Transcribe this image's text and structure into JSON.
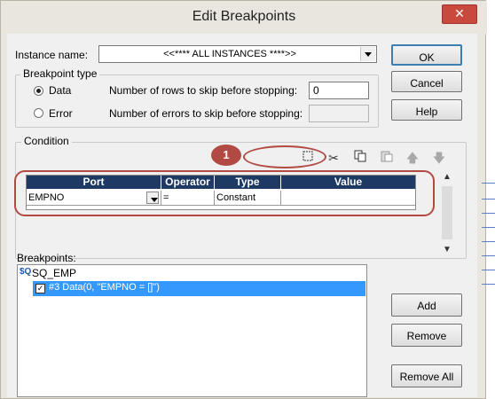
{
  "window": {
    "title": "Edit Breakpoints",
    "close_glyph": "✕"
  },
  "instance": {
    "label": "Instance name:",
    "value": "<<**** ALL INSTANCES ****>>"
  },
  "buttons": {
    "ok": "OK",
    "cancel": "Cancel",
    "help": "Help",
    "add": "Add",
    "remove": "Remove",
    "remove_all": "Remove All"
  },
  "breakpoint_type": {
    "title": "Breakpoint type",
    "data": {
      "label": "Data",
      "selected": true,
      "skip_label": "Number of rows to skip before stopping:",
      "skip_value": "0"
    },
    "error": {
      "label": "Error",
      "selected": false,
      "skip_label": "Number of errors to skip before stopping:",
      "skip_value": ""
    }
  },
  "condition": {
    "title": "Condition",
    "toolbar": [
      "new-icon",
      "cut-icon",
      "copy-icon",
      "paste-icon",
      "move-up-icon",
      "move-down-icon"
    ],
    "columns": [
      "Port",
      "Operator",
      "Type",
      "Value"
    ],
    "rows": [
      {
        "port": "EMPNO",
        "operator": "=",
        "type": "Constant",
        "value": ""
      }
    ]
  },
  "annotation": {
    "callout_number": "1",
    "color": "#b14a43"
  },
  "breakpoints": {
    "label": "Breakpoints:",
    "tree": [
      {
        "name": "SQ_EMP",
        "icon": "source-qualifier-icon",
        "children": [
          {
            "text": "#3 Data(0, \"EMPNO = []\")",
            "checked": true
          }
        ]
      }
    ]
  },
  "colors": {
    "grid_header": "#1e3a64",
    "selection": "#3399ff",
    "dialog_bg": "#f0f0f0"
  }
}
